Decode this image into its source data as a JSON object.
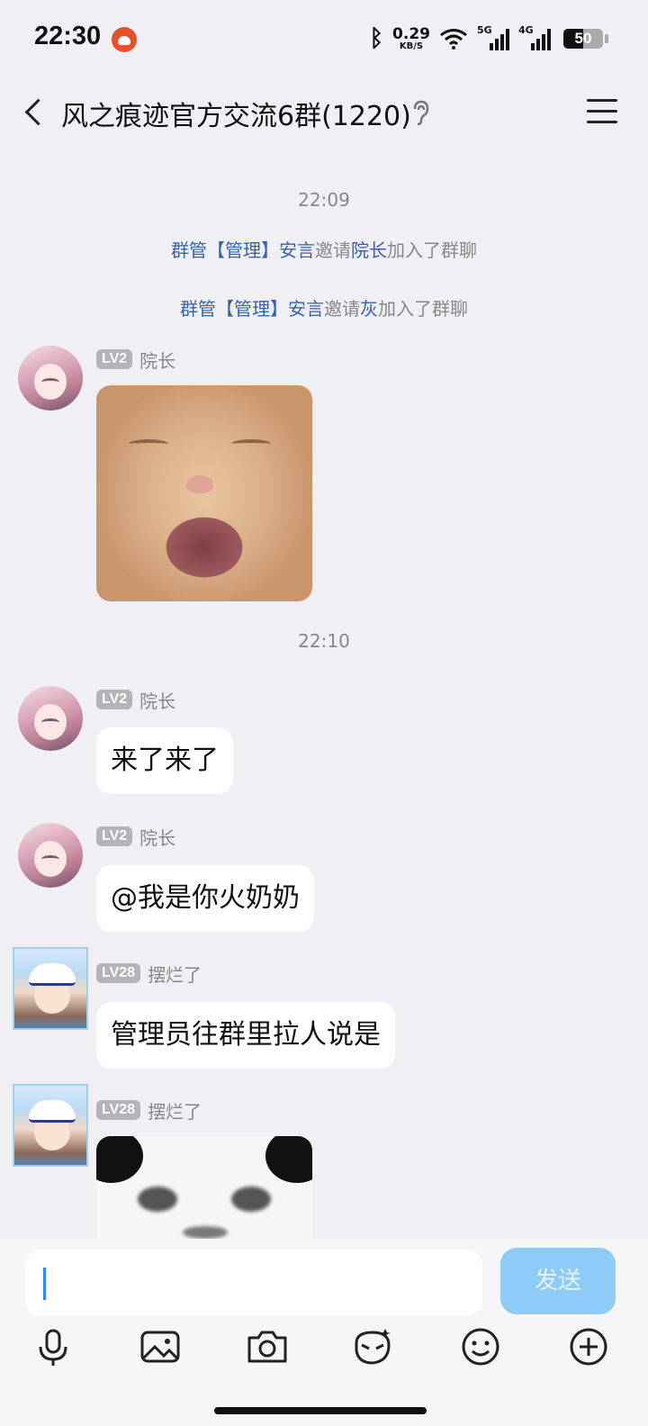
{
  "status_bar": {
    "time": "22:30",
    "net_speed": "0.29",
    "net_unit": "KB/S",
    "sig1_label": "5G",
    "sig2_label": "4G",
    "battery": "50"
  },
  "header": {
    "title": "风之痕迹官方交流6群(1220)"
  },
  "chat": {
    "time1": "22:09",
    "sys1": {
      "a": "群管【管理】安言",
      "b": "邀请",
      "c": "院长",
      "d": "加入了群聊"
    },
    "sys2": {
      "a": "群管【管理】安言",
      "b": "邀请",
      "c": "灰",
      "d": "加入了群聊"
    },
    "time2": "22:10",
    "messages": [
      {
        "level": "LV2",
        "name": "院长"
      },
      {
        "level": "LV2",
        "name": "院长",
        "text": "来了来了"
      },
      {
        "level": "LV2",
        "name": "院长",
        "text": "@我是你火奶奶"
      },
      {
        "level": "LV28",
        "name": "摆烂了",
        "text": "管理员往群里拉人说是"
      },
      {
        "level": "LV28",
        "name": "摆烂了"
      }
    ]
  },
  "input": {
    "value": "",
    "send_label": "发送"
  },
  "colors": {
    "background": "#f0f0f4",
    "link_blue": "#3761a8",
    "send_button": "#8ecbf7"
  },
  "icons": [
    "bluetooth-icon",
    "wifi-icon",
    "ear-icon",
    "menu-icon",
    "microphone-icon",
    "image-icon",
    "camera-icon",
    "sticker-icon",
    "emoji-icon",
    "plus-icon"
  ]
}
